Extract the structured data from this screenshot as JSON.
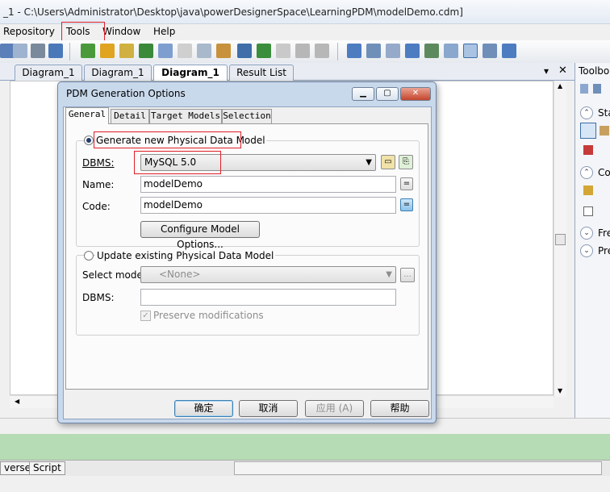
{
  "window": {
    "title": "_1 - C:\\Users\\Administrator\\Desktop\\java\\powerDesignerSpace\\LearningPDM\\modelDemo.cdm]"
  },
  "menu": {
    "items": [
      "Repository",
      "Tools",
      "Window",
      "Help"
    ]
  },
  "tabs": [
    "Diagram_1",
    "Diagram_1",
    "Diagram_1",
    "Result List"
  ],
  "tab_controls": {
    "dropdown": "▾",
    "close": "✕"
  },
  "toolbox": {
    "title": "Toolbo",
    "sections": [
      "Sta",
      "Co",
      "Fre",
      "Pre"
    ]
  },
  "bottom_tabs": [
    "verse",
    "Script"
  ],
  "dialog": {
    "title": "PDM Generation Options",
    "tabs": [
      "General",
      "Detail",
      "Target Models",
      "Selection"
    ],
    "generate_new_label": "Generate new Physical Data Model",
    "dbms_label": "DBMS:",
    "dbms_value": "MySQL 5.0",
    "name_label": "Name:",
    "name_value": "modelDemo",
    "code_label": "Code:",
    "code_value": "modelDemo",
    "code_eq": "=",
    "name_eq": "=",
    "configure_button": "Configure Model Options...",
    "update_existing_label": "Update existing Physical Data Model",
    "select_model_label": "Select model:",
    "select_model_value": "<None>",
    "dbms2_label": "DBMS:",
    "preserve_label": "Preserve modifications",
    "ellipsis": "...",
    "buttons": {
      "ok": "确定",
      "cancel": "取消",
      "apply": "应用 (A)",
      "help": "帮助"
    }
  },
  "colors": {
    "highlight_box": "#e0202a",
    "status_green": "#b5dcb5"
  }
}
